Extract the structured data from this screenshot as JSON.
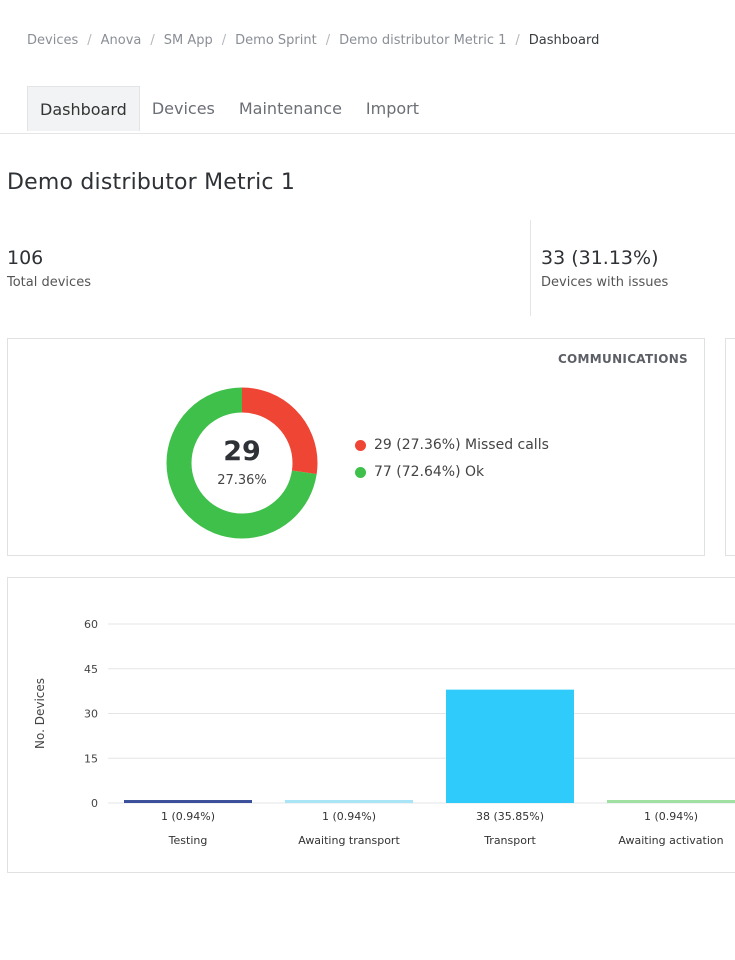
{
  "breadcrumb": {
    "items": [
      "Devices",
      "Anova",
      "SM App",
      "Demo Sprint",
      "Demo distributor Metric 1"
    ],
    "current": "Dashboard",
    "separator": "/"
  },
  "tabs": [
    {
      "label": "Dashboard",
      "active": true
    },
    {
      "label": "Devices",
      "active": false
    },
    {
      "label": "Maintenance",
      "active": false
    },
    {
      "label": "Import",
      "active": false
    }
  ],
  "page_title": "Demo distributor Metric 1",
  "stats": {
    "total": {
      "value": "106",
      "label": "Total devices"
    },
    "issues": {
      "value": "33 (31.13%)",
      "label": "Devices with issues"
    }
  },
  "communications": {
    "title": "COMMUNICATIONS",
    "center_value": "29",
    "center_pct": "27.36%",
    "legend": [
      {
        "text": "29 (27.36%) Missed calls",
        "color": "#ef4534",
        "value": 29
      },
      {
        "text": "77 (72.64%) Ok",
        "color": "#3ec04a",
        "value": 77
      }
    ]
  },
  "chart_data": {
    "type": "bar",
    "ylabel": "No. Devices",
    "xlabel": "",
    "ylim": [
      0,
      60
    ],
    "yticks": [
      0,
      15,
      30,
      45,
      60
    ],
    "categories": [
      "Testing",
      "Awaiting transport",
      "Transport",
      "Awaiting activation"
    ],
    "values": [
      1,
      1,
      38,
      1
    ],
    "data_labels": [
      "1 (0.94%)",
      "1 (0.94%)",
      "38 (35.85%)",
      "1 (0.94%)"
    ],
    "colors": [
      "#3c4f9a",
      "#a9e5f7",
      "#2ecbfb",
      "#9fe0a0"
    ],
    "grid": true
  }
}
